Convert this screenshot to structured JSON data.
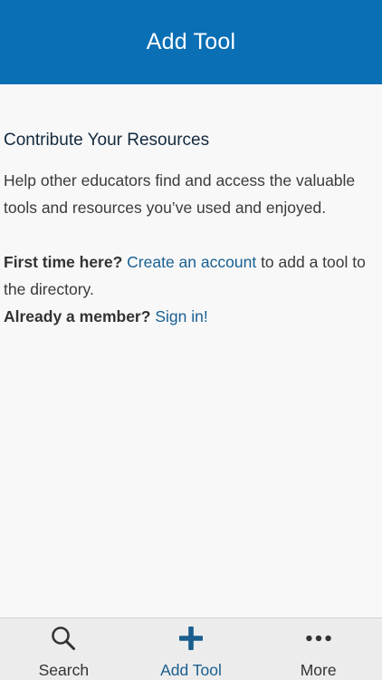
{
  "header": {
    "title": "Add Tool"
  },
  "content": {
    "heading": "Contribute Your Resources",
    "intro": "Help other educators find and access the valuable tools and resources you’ve used and enjoyed.",
    "first_time": {
      "prefix": "First time here?",
      "link": "Create an account",
      "suffix": "to add a tool to the directory."
    },
    "member": {
      "prefix": "Already a member?",
      "link": "Sign in!"
    }
  },
  "tabbar": {
    "tabs": [
      {
        "label": "Search",
        "icon": "search-icon",
        "active": false
      },
      {
        "label": "Add Tool",
        "icon": "plus-icon",
        "active": true
      },
      {
        "label": "More",
        "icon": "more-icon",
        "active": false
      }
    ]
  },
  "colors": {
    "header_bg": "#0a6fb5",
    "link": "#175f92",
    "active_tab": "#1a5e8e"
  }
}
